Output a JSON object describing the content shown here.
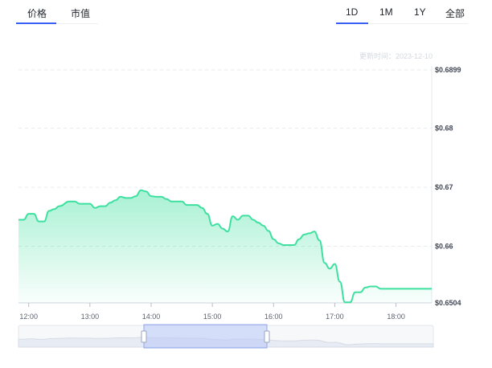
{
  "tabs_left": [
    {
      "label": "价格",
      "active": true
    },
    {
      "label": "市值",
      "active": false
    }
  ],
  "tabs_right": [
    {
      "label": "1D",
      "active": true
    },
    {
      "label": "1M",
      "active": false
    },
    {
      "label": "1Y",
      "active": false
    },
    {
      "label": "全部",
      "active": false
    }
  ],
  "updated": "更新时间：2023-12-10",
  "colors": {
    "line": "#3ee0a0",
    "accent": "#3860f4",
    "grid": "#e6e9ee",
    "navigator": "#b9c8f8"
  },
  "chart_data": {
    "type": "area",
    "x_tick_labels": [
      "12:00",
      "13:00",
      "14:00",
      "15:00",
      "16:00",
      "17:00",
      "18:00"
    ],
    "y_tick_labels": [
      "$0.6899",
      "$0.68",
      "$0.67",
      "$0.66",
      "$0.6504"
    ],
    "ylim": [
      0.6504,
      0.6899
    ],
    "xlim": [
      "11:50",
      "18:35"
    ],
    "grid": true,
    "series": [
      {
        "x": [
          "11:50",
          "11:55",
          "12:00",
          "12:05",
          "12:10",
          "12:15",
          "12:20",
          "12:25",
          "12:30",
          "12:40",
          "12:45",
          "12:50",
          "12:55",
          "13:00",
          "13:05",
          "13:10",
          "13:15",
          "13:20",
          "13:25",
          "13:30",
          "13:35",
          "13:40",
          "13:45",
          "13:50",
          "13:55",
          "14:00",
          "14:05",
          "14:10",
          "14:15",
          "14:20",
          "14:25",
          "14:30",
          "14:35",
          "14:40",
          "14:45",
          "14:50",
          "14:55",
          "15:00",
          "15:05",
          "15:10",
          "15:15",
          "15:20",
          "15:25",
          "15:30",
          "15:35",
          "15:40",
          "15:45",
          "15:50",
          "15:55",
          "16:00",
          "16:05",
          "16:10",
          "16:15",
          "16:20",
          "16:25",
          "16:30",
          "16:35",
          "16:40",
          "16:45",
          "16:50",
          "16:55",
          "17:00",
          "17:05",
          "17:10",
          "17:15",
          "17:20",
          "17:25",
          "17:30",
          "17:35",
          "17:40",
          "17:45",
          "17:50",
          "17:55",
          "18:00",
          "18:05",
          "18:10",
          "18:15",
          "18:20",
          "18:25",
          "18:30",
          "18:35"
        ],
        "values": [
          0.6645,
          0.6645,
          0.6655,
          0.6655,
          0.6642,
          0.6642,
          0.666,
          0.6663,
          0.6668,
          0.6676,
          0.6676,
          0.6672,
          0.6672,
          0.6672,
          0.6665,
          0.6668,
          0.6668,
          0.6674,
          0.6678,
          0.6684,
          0.6682,
          0.6682,
          0.6685,
          0.6695,
          0.6693,
          0.6685,
          0.6684,
          0.6684,
          0.668,
          0.6676,
          0.6676,
          0.6676,
          0.667,
          0.667,
          0.667,
          0.6665,
          0.6655,
          0.6635,
          0.6638,
          0.663,
          0.6625,
          0.6651,
          0.6645,
          0.6652,
          0.6652,
          0.6645,
          0.664,
          0.6635,
          0.6626,
          0.6612,
          0.6605,
          0.6602,
          0.6602,
          0.6602,
          0.6612,
          0.662,
          0.6622,
          0.6625,
          0.661,
          0.6572,
          0.6562,
          0.657,
          0.654,
          0.6505,
          0.6505,
          0.6522,
          0.6522,
          0.653,
          0.6532,
          0.6532,
          0.6528,
          0.6528,
          0.6528,
          0.6528,
          0.6528,
          0.6528,
          0.6528,
          0.6528,
          0.6528,
          0.6528,
          0.6528
        ]
      }
    ]
  }
}
